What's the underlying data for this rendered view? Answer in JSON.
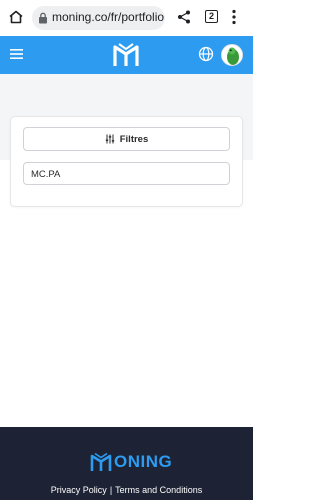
{
  "browser": {
    "url": "moning.co/fr/portfolio",
    "tab_count": "2"
  },
  "colors": {
    "brand": "#2d9cf0",
    "footer_bg": "#1d2234",
    "band_bg": "#f4f5f7"
  },
  "icons": {
    "home": "home-icon",
    "lock": "lock-icon",
    "share": "share-icon",
    "more": "more-vert-icon",
    "menu": "hamburger-menu-icon",
    "globe": "globe-icon",
    "filters": "sliders-icon"
  },
  "main": {
    "filters_label": "Filtres",
    "ticker_value": "MC.PA"
  },
  "footer": {
    "brand": "ONING",
    "privacy": "Privacy Policy",
    "separator": "|",
    "terms": "Terms and Conditions"
  }
}
